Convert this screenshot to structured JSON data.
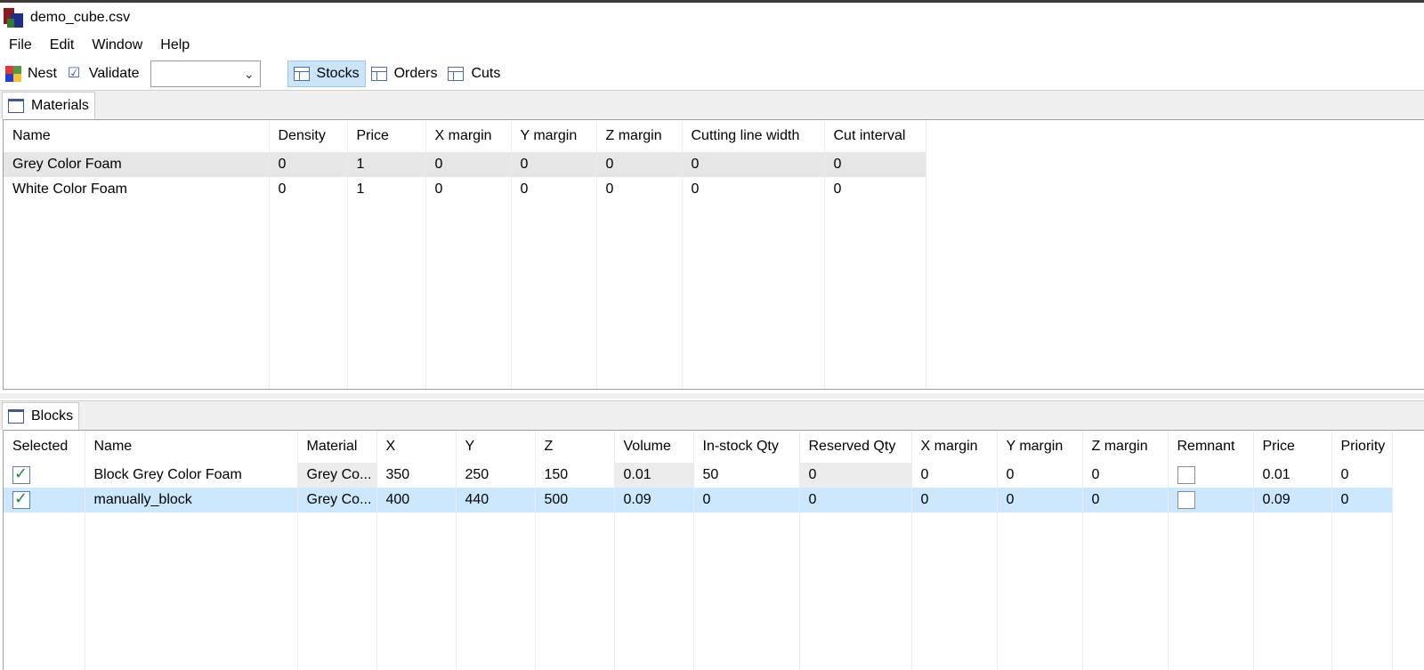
{
  "window": {
    "title": "demo_cube.csv"
  },
  "menu": [
    "File",
    "Edit",
    "Window",
    "Help"
  ],
  "toolbar": {
    "nest": "Nest",
    "validate": "Validate",
    "combo_value": "",
    "stocks": "Stocks",
    "orders": "Orders",
    "cuts": "Cuts"
  },
  "materials": {
    "tab": "Materials",
    "columns": [
      "Name",
      "Density",
      "Price",
      "X margin",
      "Y margin",
      "Z margin",
      "Cutting line width",
      "Cut interval"
    ],
    "rows": [
      [
        "Grey Color Foam",
        "0",
        "1",
        "0",
        "0",
        "0",
        "0",
        "0"
      ],
      [
        "White Color Foam",
        "0",
        "1",
        "0",
        "0",
        "0",
        "0",
        "0"
      ]
    ]
  },
  "blocks": {
    "tab": "Blocks",
    "columns": [
      "Selected",
      "Name",
      "Material",
      "X",
      "Y",
      "Z",
      "Volume",
      "In-stock Qty",
      "Reserved Qty",
      "X margin",
      "Y margin",
      "Z margin",
      "Remnant",
      "Price",
      "Priority"
    ],
    "rows": [
      {
        "selected": true,
        "name": "Block Grey Color Foam",
        "material": "Grey Co...",
        "x": "350",
        "y": "250",
        "z": "150",
        "volume": "0.01",
        "in_stock": "50",
        "reserved": "0",
        "x_margin": "0",
        "y_margin": "0",
        "z_margin": "0",
        "remnant": false,
        "price": "0.01",
        "priority": "0"
      },
      {
        "selected": true,
        "name": "manually_block",
        "material": "Grey Co...",
        "x": "400",
        "y": "440",
        "z": "500",
        "volume": "0.09",
        "in_stock": "0",
        "reserved": "0",
        "x_margin": "0",
        "y_margin": "0",
        "z_margin": "0",
        "remnant": false,
        "price": "0.09",
        "priority": "0"
      }
    ]
  }
}
